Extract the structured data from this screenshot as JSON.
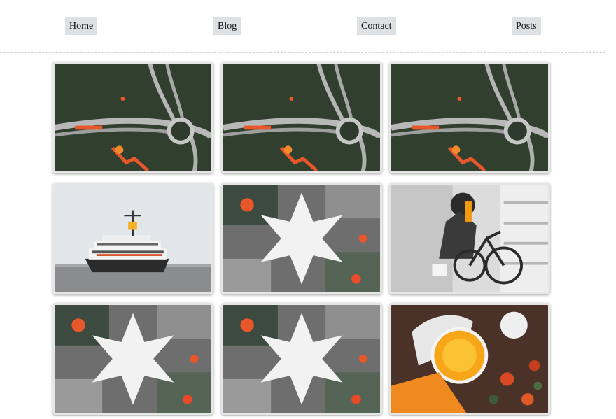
{
  "nav": {
    "items": [
      {
        "label": "Home"
      },
      {
        "label": "Blog"
      },
      {
        "label": "Contact"
      },
      {
        "label": "Posts"
      }
    ]
  },
  "gallery": {
    "images": [
      {
        "subject": "highway-aerial"
      },
      {
        "subject": "highway-aerial"
      },
      {
        "subject": "highway-aerial"
      },
      {
        "subject": "ferry-boat"
      },
      {
        "subject": "hands-star"
      },
      {
        "subject": "woman-bicycle"
      },
      {
        "subject": "hands-star"
      },
      {
        "subject": "hands-star"
      },
      {
        "subject": "orange-slice"
      }
    ]
  }
}
